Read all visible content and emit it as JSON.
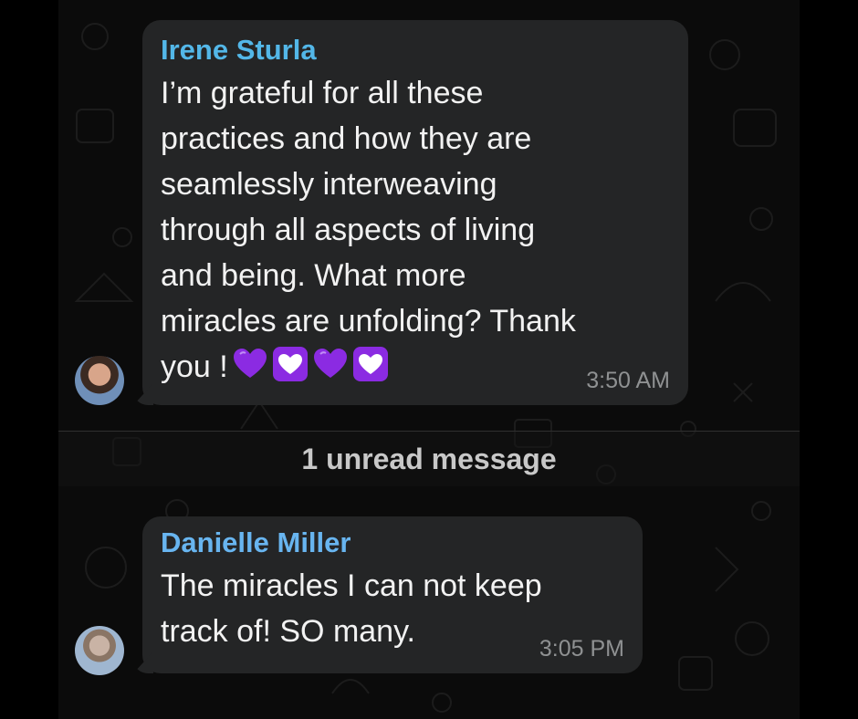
{
  "messages": [
    {
      "sender": "Irene Sturla",
      "text": "I’m grateful for all these\npractices and how they are\nseamlessly interweaving\nthrough all aspects of living\nand being. What more\nmiracles are unfolding? Thank\nyou !",
      "emojis": [
        "purple-heart-icon",
        "heart-decoration-icon",
        "purple-heart-icon",
        "heart-decoration-icon"
      ],
      "time": "3:50 AM"
    },
    {
      "sender": "Danielle Miller",
      "text": "The miracles I can not keep\ntrack of! SO many.",
      "time": "3:05 PM"
    }
  ],
  "divider": {
    "label": "1 unread message"
  },
  "colors": {
    "bubble": "#242526",
    "sender1": "#53b7e8",
    "sender2": "#68b5f0",
    "purple": "#8b2be2"
  }
}
